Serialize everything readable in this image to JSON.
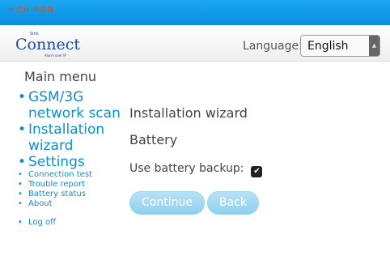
{
  "topbar": {
    "brand": "CHIRON",
    "brand_mark": "✈"
  },
  "logo": {
    "small": "Siris",
    "word": "Connect",
    "tag": "Alarm over IP"
  },
  "language": {
    "label": "Language:",
    "value": "English"
  },
  "menu": {
    "title": "Main menu",
    "items": [
      {
        "label": "GSM/3G network scan",
        "size": "big"
      },
      {
        "label": "Installation wizard",
        "size": "big"
      },
      {
        "label": "Settings",
        "size": "big"
      },
      {
        "label": "Connection test",
        "size": "small"
      },
      {
        "label": "Trouble report",
        "size": "small"
      },
      {
        "label": "Battery status",
        "size": "small"
      },
      {
        "label": "About",
        "size": "small"
      },
      {
        "label": "Log off",
        "size": "small"
      }
    ]
  },
  "content": {
    "title": "Installation wizard",
    "subtitle": "Battery",
    "battery_label": "Use battery backup:",
    "battery_checked": true,
    "continue": "Continue",
    "back": "Back"
  }
}
